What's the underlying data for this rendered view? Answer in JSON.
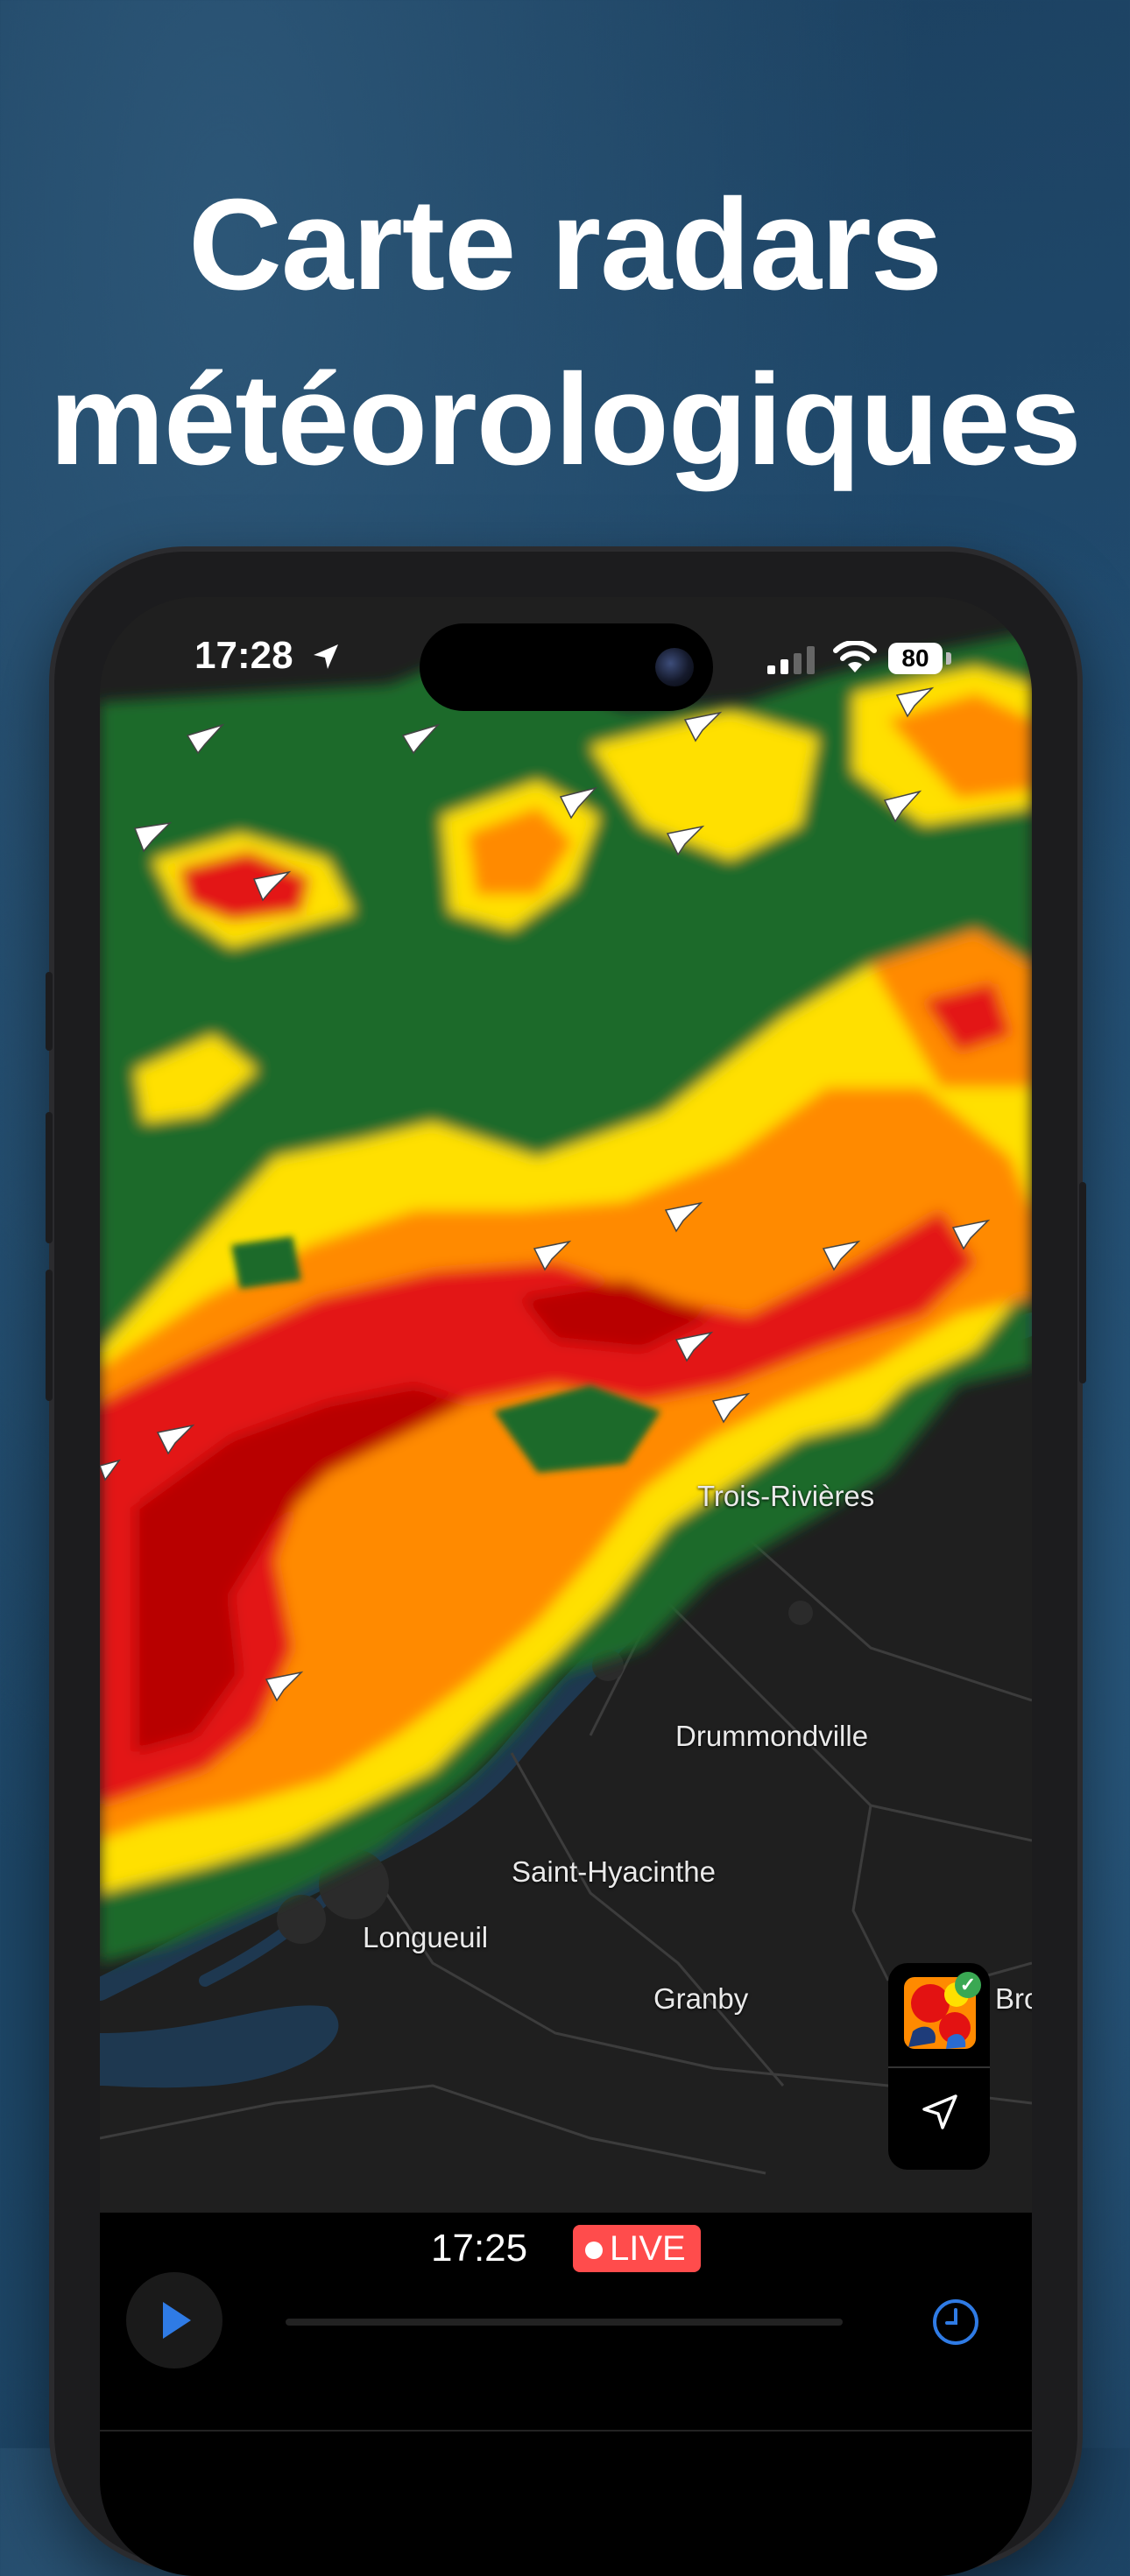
{
  "headline": {
    "line1": "Carte radars",
    "line2": "météorologiques"
  },
  "status_bar": {
    "time": "17:28",
    "battery": "80"
  },
  "map": {
    "cities": [
      {
        "id": "trois-rivieres",
        "label": "Trois-Rivières"
      },
      {
        "id": "drummondville",
        "label": "Drummondville"
      },
      {
        "id": "saint-hyacinthe",
        "label": "Saint-Hyacinthe"
      },
      {
        "id": "longueuil",
        "label": "Longueuil"
      },
      {
        "id": "granby",
        "label": "Granby"
      },
      {
        "id": "brome",
        "label": "Bro"
      }
    ],
    "colors": {
      "green": "#1e6b2a",
      "yellow": "#ffe000",
      "orange": "#ff8a00",
      "red": "#e31212",
      "darkred": "#b80000"
    }
  },
  "player": {
    "time": "17:25",
    "live_label": "LIVE",
    "accent": "#2f7be5",
    "live_color": "#ff4c4c"
  }
}
